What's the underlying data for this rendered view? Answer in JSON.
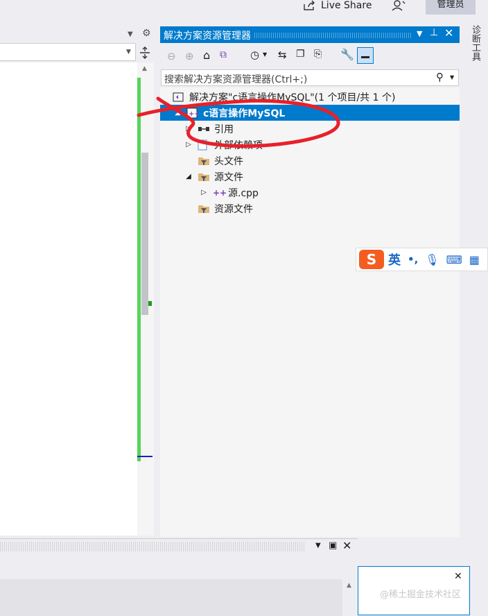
{
  "topbar": {
    "live_share": "Live Share",
    "admin": "管理员"
  },
  "solution_explorer": {
    "title": "解决方案资源管理器",
    "search_placeholder": "搜索解决方案资源管理器(Ctrl+;)",
    "tree": [
      {
        "label": "解决方案\"c语言操作MySQL\"(1 个项目/共 1 个)",
        "icon": "solution-icon",
        "indent": 0,
        "toggle": ""
      },
      {
        "label": "c语言操作MySQL",
        "icon": "cpp-project-icon",
        "indent": 1,
        "toggle": "expanded",
        "selected": true
      },
      {
        "label": "引用",
        "icon": "references-icon",
        "indent": 2,
        "toggle": "collapsed"
      },
      {
        "label": "外部依赖项",
        "icon": "external-deps-icon",
        "indent": 2,
        "toggle": "collapsed"
      },
      {
        "label": "头文件",
        "icon": "filter-folder-icon",
        "indent": 2,
        "toggle": ""
      },
      {
        "label": "源文件",
        "icon": "filter-folder-icon",
        "indent": 2,
        "toggle": "expanded"
      },
      {
        "label": "源.cpp",
        "icon": "cpp-file-icon",
        "indent": 3,
        "toggle": "collapsed"
      },
      {
        "label": "资源文件",
        "icon": "filter-folder-icon",
        "indent": 2,
        "toggle": ""
      }
    ]
  },
  "diagnostics_tab": "诊断工具",
  "ime": {
    "mode": "英",
    "punct": "•,"
  },
  "watermark": "@稀土掘金技术社区",
  "colors": {
    "accent": "#007acc",
    "annotation": "#e8202a",
    "ime_logo": "#f45d22"
  }
}
